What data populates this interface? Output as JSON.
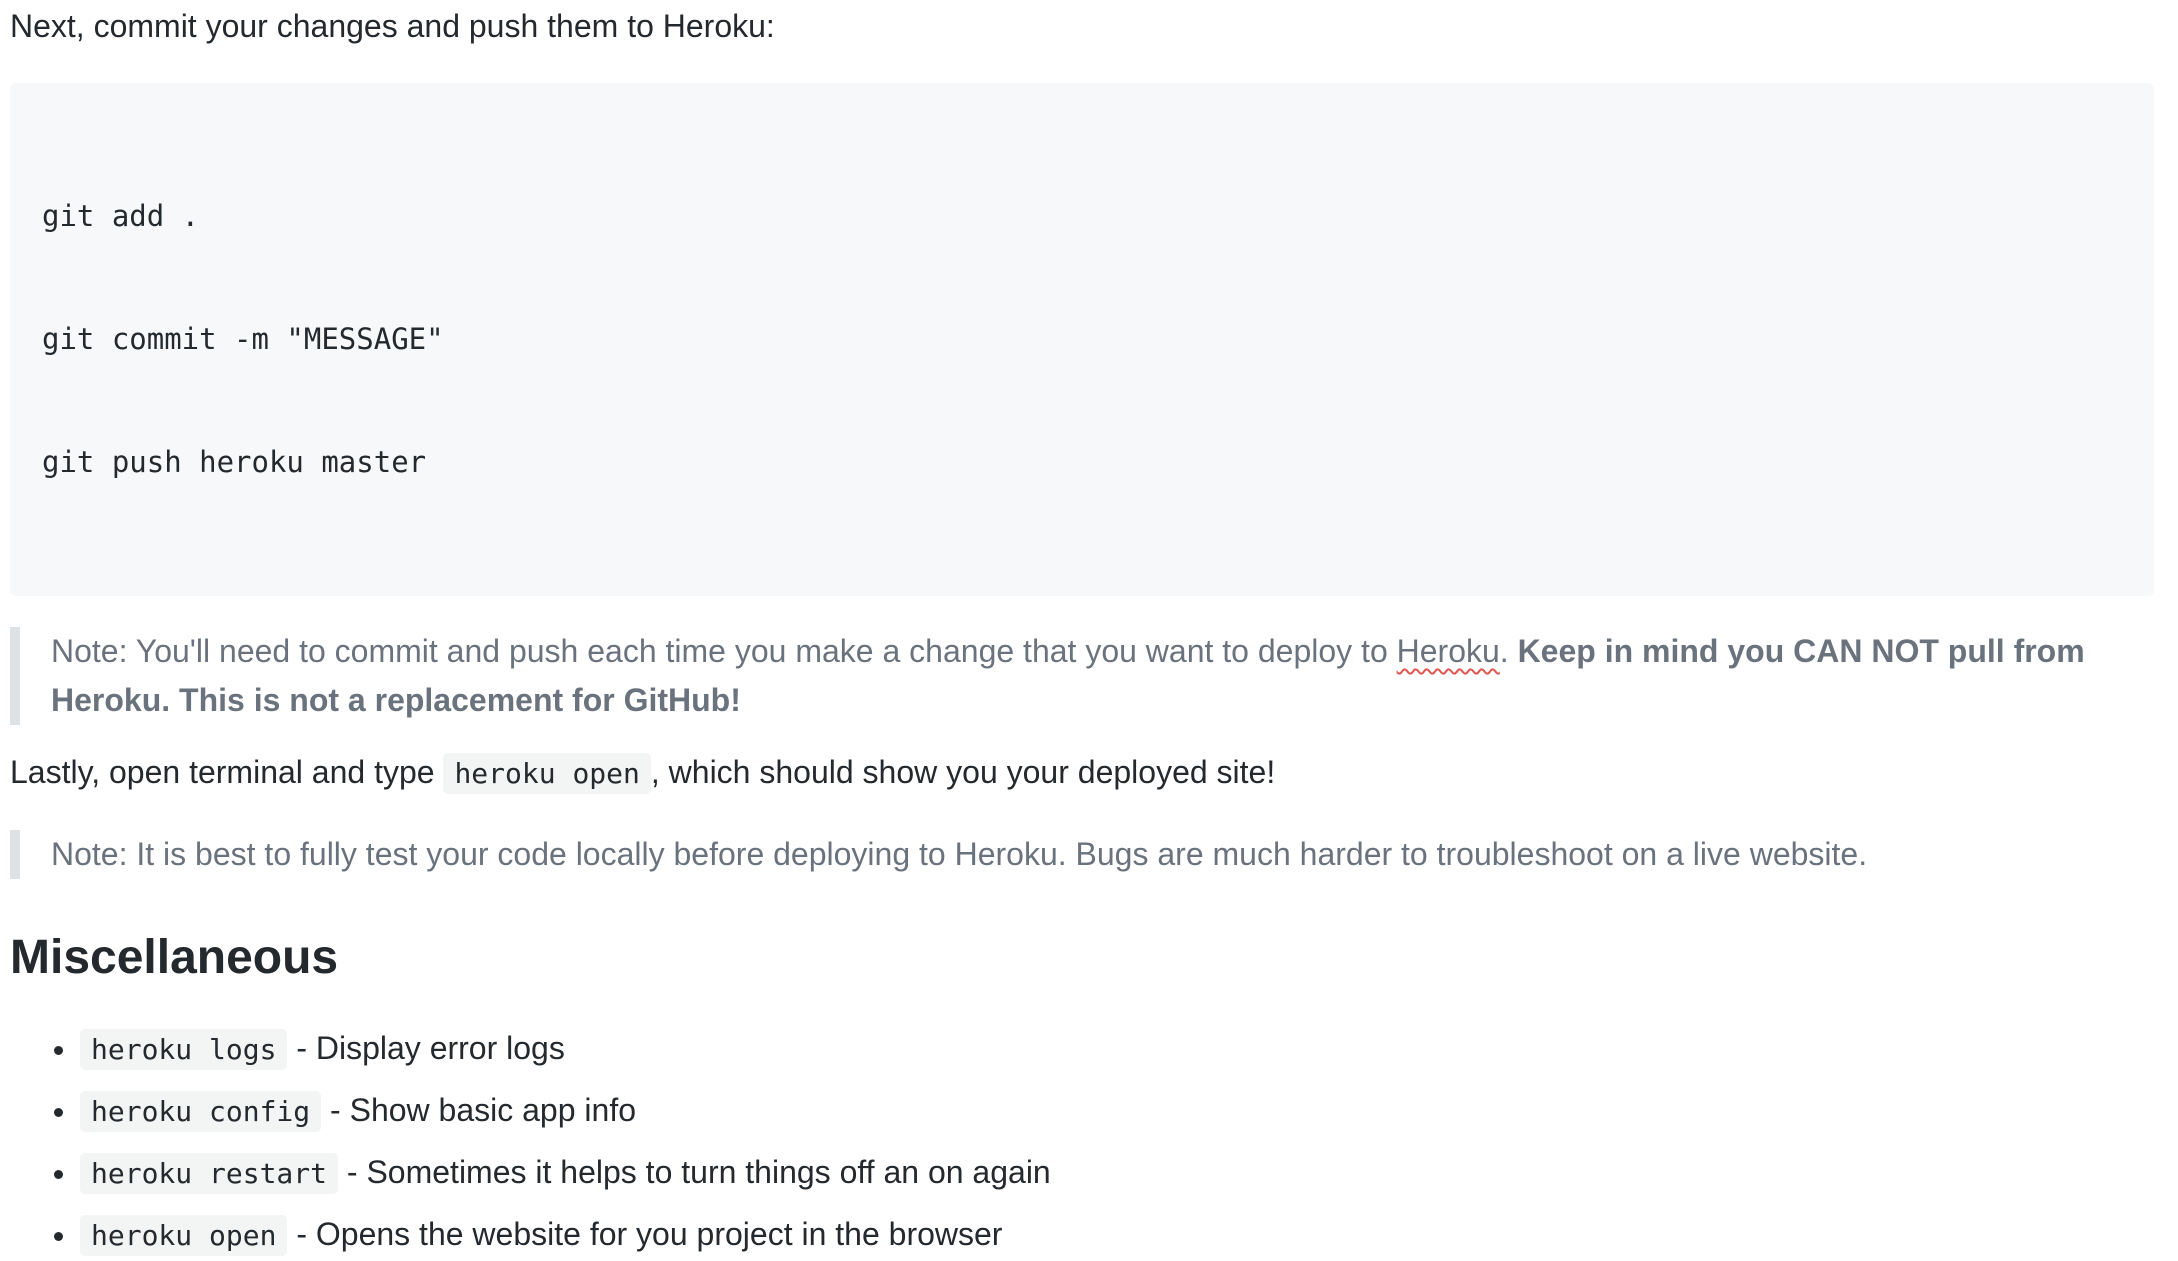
{
  "intro": "Next, commit your changes and push them to Heroku:",
  "code_block": {
    "lines": [
      "git add .",
      "git commit -m \"MESSAGE\"",
      "git push heroku master"
    ]
  },
  "note1": {
    "text_before": "Note: You'll need to commit and push each time you make a change that you want to deploy to ",
    "highlight_word": "Heroku",
    "text_after": ". ",
    "bold": "Keep in mind you CAN NOT pull from Heroku. This is not a replacement for GitHub!"
  },
  "lastly": {
    "before": "Lastly, open terminal and type ",
    "code": "heroku open",
    "after": ", which should show you your deployed site!"
  },
  "note2": "Note: It is best to fully test your code locally before deploying to Heroku. Bugs are much harder to troubleshoot on a live website.",
  "heading": "Miscellaneous",
  "misc_items": [
    {
      "code": "heroku logs",
      "desc": " - Display error logs"
    },
    {
      "code": "heroku config",
      "desc": " - Show basic app info"
    },
    {
      "code": "heroku restart",
      "desc": " - Sometimes it helps to turn things off an on again"
    },
    {
      "code": "heroku open",
      "desc": " - Opens the website for you project in the browser"
    }
  ]
}
